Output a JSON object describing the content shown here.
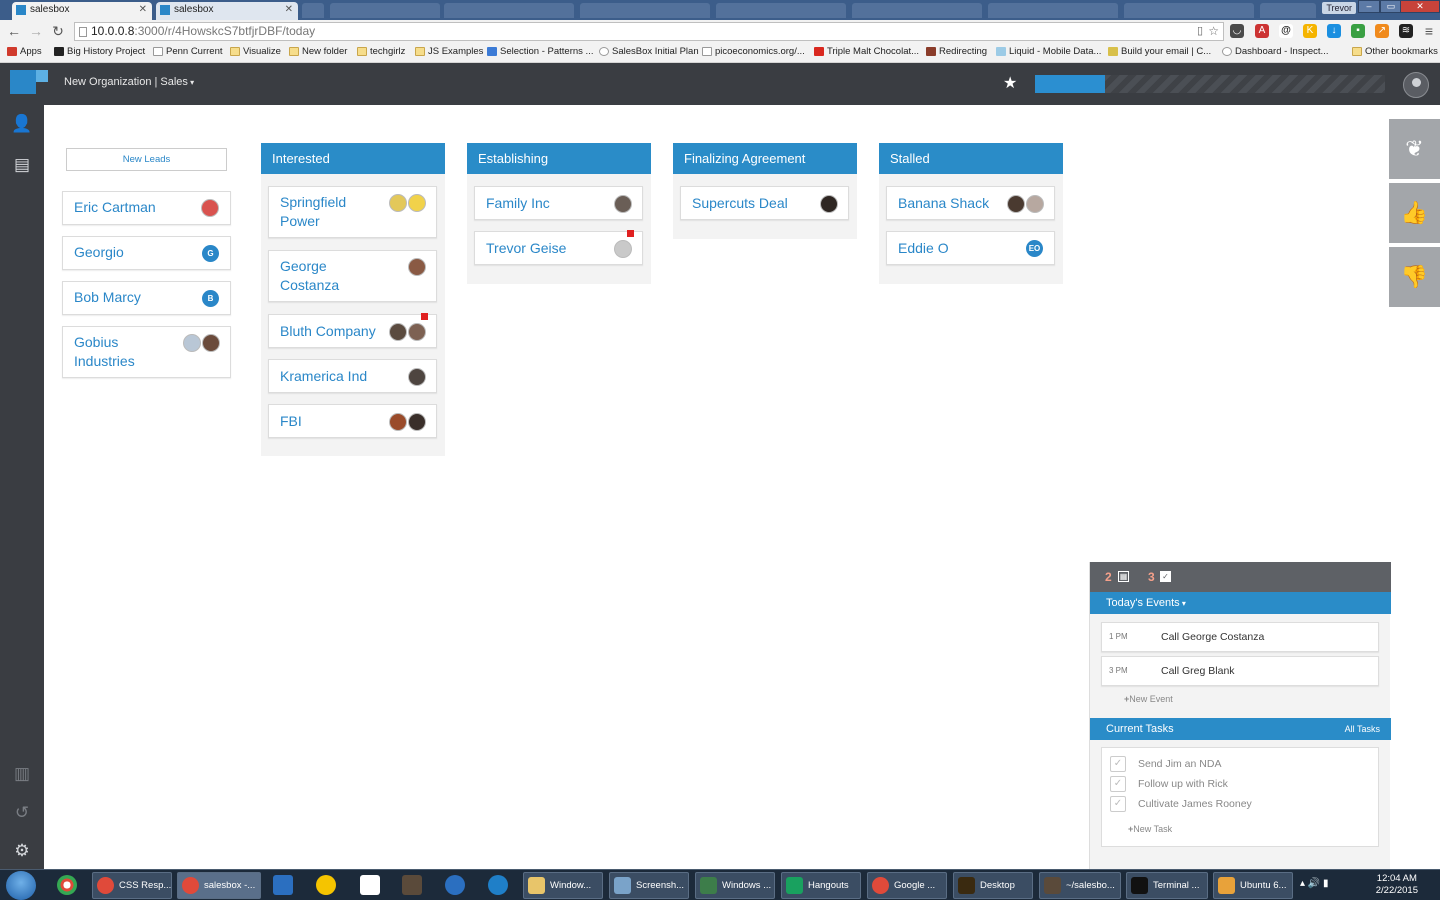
{
  "browser": {
    "tabs": [
      {
        "title": "salesbox",
        "active": true
      },
      {
        "title": "salesbox",
        "active": false
      }
    ],
    "window_user": "Trevor",
    "url_host": "10.0.0.8",
    "url_path": ":3000/r/4HowskcS7btfjrDBF/today",
    "bookmarks": [
      "Apps",
      "Big History Project",
      "Penn Current",
      "Visualize",
      "New folder",
      "techgirlz",
      "JS Examples",
      "Selection - Patterns ...",
      "SalesBox Initial Plan",
      "picoeconomics.org/...",
      "Triple Malt Chocolat...",
      "Redirecting",
      "Liquid - Mobile Data...",
      "Build your email | C...",
      "Dashboard - Inspect...",
      "Other bookmarks"
    ]
  },
  "app": {
    "org_menu": "New Organization | Sales",
    "goal_progress_fraction": 0.2,
    "colors": {
      "accent": "#2a8cc8",
      "header": "#3a3d42",
      "flag": "#e02020"
    }
  },
  "new_leads": {
    "button": "New Leads",
    "items": [
      {
        "name": "Eric Cartman"
      },
      {
        "name": "Georgio",
        "initial": "G"
      },
      {
        "name": "Bob Marcy",
        "initial": "B"
      },
      {
        "name": "Gobius Industries"
      }
    ]
  },
  "columns": [
    {
      "title": "Interested",
      "cards": [
        {
          "name": "Springfield Power"
        },
        {
          "name": "George Costanza"
        },
        {
          "name": "Bluth Company"
        },
        {
          "name": "Kramerica Ind"
        },
        {
          "name": "FBI"
        }
      ]
    },
    {
      "title": "Establishing",
      "cards": [
        {
          "name": "Family Inc"
        },
        {
          "name": "Trevor Geise"
        }
      ]
    },
    {
      "title": "Finalizing Agreement",
      "cards": [
        {
          "name": "Supercuts Deal"
        }
      ]
    },
    {
      "title": "Stalled",
      "cards": [
        {
          "name": "Banana Shack"
        },
        {
          "name": "Eddie O",
          "initial": "EO"
        }
      ]
    }
  ],
  "right_actions": [
    "leaf-icon",
    "thumbs-up-icon",
    "thumbs-down-icon"
  ],
  "widget": {
    "event_count": "2",
    "task_count": "3",
    "events_header": "Today's Events",
    "events": [
      {
        "time": "1 PM",
        "title": "Call George Costanza"
      },
      {
        "time": "3 PM",
        "title": "Call Greg Blank"
      }
    ],
    "new_event": "New Event",
    "tasks_header": "Current Tasks",
    "all_tasks": "All Tasks",
    "tasks": [
      "Send Jim an NDA",
      "Follow up with Rick",
      "Cultivate James Rooney"
    ],
    "new_task": "New Task"
  },
  "taskbar": {
    "buttons": [
      "CSS Resp...",
      "salesbox -...",
      "Window...",
      "Screensh...",
      "Windows ...",
      "Hangouts",
      "Google ...",
      "Desktop",
      "~/salesbo...",
      "Terminal ...",
      "Ubuntu 6..."
    ],
    "time": "12:04 AM",
    "date": "2/22/2015"
  }
}
